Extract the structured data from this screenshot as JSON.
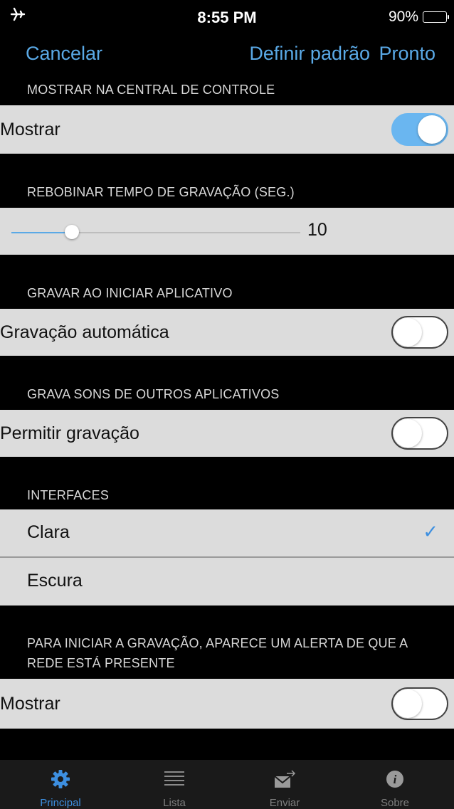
{
  "status_bar": {
    "time": "8:55 PM",
    "battery": "90%",
    "airplane_icon": "airplane-icon"
  },
  "nav": {
    "cancel": "Cancelar",
    "set_default": "Definir padrão",
    "done": "Pronto"
  },
  "sections": {
    "control_center": {
      "header": "MOSTRAR NA CENTRAL DE CONTROLE",
      "row_label": "Mostrar",
      "toggle_on": true
    },
    "rewind": {
      "header": "REBOBINAR TEMPO DE GRAVAÇÃO (SEG.)",
      "value": "10",
      "slider_fraction": 0.21
    },
    "auto_record": {
      "header": "GRAVAR AO INICIAR APLICATIVO",
      "row_label": "Gravação automática",
      "toggle_on": false
    },
    "other_apps": {
      "header": "GRAVA SONS DE OUTROS APLICATIVOS",
      "row_label": "Permitir gravação",
      "toggle_on": false
    },
    "interfaces": {
      "header": "INTERFACES",
      "options": [
        "Clara",
        "Escura"
      ],
      "selected": "Clara"
    },
    "network_alert": {
      "header_line1": "PARA INICIAR A GRAVAÇÃO, APARECE UM ALERTA DE QUE A",
      "header_line2": "REDE ESTÁ PRESENTE",
      "row_label": "Mostrar",
      "toggle_on": false
    }
  },
  "tabs": [
    {
      "label": "Principal",
      "icon": "gear-icon",
      "active": true
    },
    {
      "label": "Lista",
      "icon": "list-icon",
      "active": false
    },
    {
      "label": "Enviar",
      "icon": "envelope-icon",
      "active": false
    },
    {
      "label": "Sobre",
      "icon": "info-icon",
      "active": false
    }
  ],
  "colors": {
    "accent": "#5aa9e6",
    "toggle_on": "#6ab6f0",
    "row_bg": "#dcdcdc",
    "background": "#000000",
    "tab_active": "#3d8fe0"
  }
}
